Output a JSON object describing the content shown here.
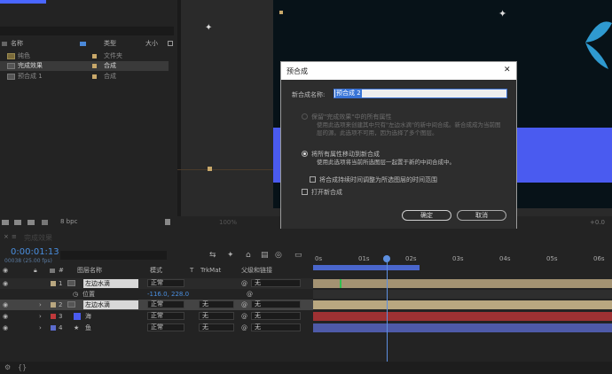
{
  "project_panel": {
    "search_placeholder": "",
    "columns": {
      "name": "名称",
      "type": "类型",
      "size": "大小"
    },
    "items": [
      {
        "name": "纯色",
        "type": "文件夹",
        "swatch": "#c8a86a"
      },
      {
        "name": "完成效果",
        "type": "合成",
        "swatch": "#c8a86a"
      },
      {
        "name": "预合成 1",
        "type": "合成",
        "swatch": "#c8a86a"
      }
    ],
    "bpc": "8 bpc"
  },
  "viewer": {
    "zoom": "100%",
    "offset": "+0.0"
  },
  "dialog": {
    "title": "预合成",
    "name_label": "新合成名称:",
    "name_value": "预合成 2",
    "option1_label": "保留\"完成效果\"中的所有属性",
    "option1_desc": "使用此选项来创建其中只有\"左边水滴\"的新中间合成。新合成成为当前图层的源。此选项不可用，因为选择了多个图层。",
    "option2_label": "将所有属性移动到新合成",
    "option2_desc": "使用此选项将当前所选图层一起置于新的中间合成中。",
    "adjust_label": "将合成持续时间调整为所选图层的时间范围",
    "open_label": "打开新合成",
    "ok_label": "确定",
    "cancel_label": "取消",
    "close_glyph": "✕"
  },
  "timeline": {
    "tab_label": "完成效果",
    "timecode": "0:00:01:13",
    "fps": "00038 (25.00 fps)",
    "headers": {
      "layer_name": "图层名称",
      "mode": "模式",
      "t": "T",
      "trkmat": "TrkMat",
      "parent": "父级和链接"
    },
    "ruler": [
      "0s",
      "01s",
      "02s",
      "03s",
      "04s",
      "05s",
      "06s"
    ],
    "layers": [
      {
        "num": "1",
        "name": "左边水滴",
        "mode": "正常",
        "trkmat": "",
        "parent": "无",
        "label": "#b9a780"
      },
      {
        "num": "2",
        "name": "左边水滴",
        "mode": "正常",
        "trkmat": "无",
        "parent": "无",
        "label": "#b9a780"
      },
      {
        "num": "3",
        "name": "海",
        "mode": "正常",
        "trkmat": "无",
        "parent": "无",
        "label": "#c0393b"
      },
      {
        "num": "4",
        "name": "鱼",
        "mode": "正常",
        "trkmat": "无",
        "parent": "无",
        "label": "#5b6bcc"
      }
    ],
    "position": {
      "label": "位置",
      "value": "-116.0, 228.0"
    }
  }
}
